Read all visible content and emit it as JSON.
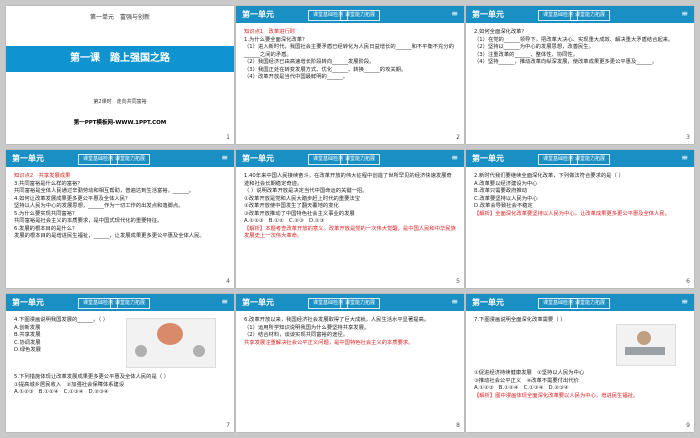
{
  "header": {
    "unit": "第一单元",
    "tag1": "课堂基础检测",
    "tag2": "课堂能力拓展",
    "menu": "≡"
  },
  "slide1": {
    "title_line": "第一单元　富强与创新",
    "band": "第一课　踏上强国之路",
    "subtitle": "第2课时　走向共同富裕",
    "footer": "第一PPT模板网-WWW.1PPT.COM",
    "num": "1"
  },
  "slide2": {
    "lines": [
      "知识点1　改革进行时",
      "1.为什么要全面深化改革？",
      "（1）进入新时代，我国社会主要矛盾已经转化为人民日益增长的______和不平衡不充分的______之间的矛盾。",
      "（2）我国经济已由高速增长阶段转向______发展阶段。",
      "（3）我国正处在转变发展方式、优化______、转换______的攻关期。",
      "（4）改革开放是当代中国最鲜明的______。"
    ],
    "num": "2"
  },
  "slide3": {
    "lines": [
      "2.如何全面深化改革？",
      "（1）在党的______领导下，把改革大决心、实现重大成效、解决重大矛盾结合起来。",
      "（2）坚持以______为中心的发展思想，改善民生。",
      "（3）注重改革的______、整体性、协同性。",
      "（4）坚持______，推动改革向纵深发展，使改革成果更多更公平惠及______。"
    ],
    "num": "3"
  },
  "slide4": {
    "lines": [
      "知识点2　共享发展成果",
      "3.共同富裕是什么样的富裕？",
      "共同富裕是全体人民通过辛勤劳动和相互帮助，普遍达到生活富裕，______。",
      "4.如何让改革发展成果更多更公平惠及全体人民？",
      "坚持以人民为中心的发展思想，______作为一切工作的出发点和落脚点。",
      "5.为什么要实现共同富裕？",
      "共同富裕是社会主义的本质要求，是中国式现代化的重要特征。",
      "6.发展的根本目的是什么？",
      "发展的根本目的是增进民生福祉，______，让发展成果更多更公平惠及全体人民。"
    ],
    "num": "4"
  },
  "slide5": {
    "lines": [
      "1.40年来中国人民接续奋斗，在改革开放的伟大征程中创造了世所罕见的经济快速发展奇迹和社会长期稳定奇迹。",
      "（ ）说明改革开放是决定当代中国命运的关键一招。",
      "①改革开放是党和人民大踏步赶上时代的重要法宝",
      "②改革开放使中国发生了翻天覆地的变化",
      "③改革开放推动了中国特色社会主义事业的发展",
      "A.①②③　B.①②　C.②③　D.①③",
      "【解析】本题考查改革开放的意义。改革开放是党的一次伟大觉醒，是中国人民和中华民族发展史上一次伟大革命。"
    ],
    "num": "5"
  },
  "slide6": {
    "lines": [
      "2.新时代我们要继续全面深化改革，下列做法符合要求的是（ ）",
      "A.改革要以经济建设为中心",
      "B.改革只需要政府推动",
      "C.改革要坚持以人民为中心",
      "D.改革会导致社会不稳定",
      "【解析】全面深化改革要坚持以人民为中心，让改革成果更多更公平惠及全体人民。"
    ],
    "num": "6"
  },
  "slide7": {
    "lines": [
      "4.下图漫画说明我国发展的______。（ ）",
      "A.创新发展",
      "B.共享发展",
      "C.协调发展",
      "D.绿色发展",
      "5.下列措施体现让改革发展成果更多更公平惠及全体人民的是（ ）",
      "①提高城乡居民收入　②加强社会保障体系建设",
      "A.①②③　B.①②④　C.①③④　D.②③④"
    ],
    "num": "7"
  },
  "slide8": {
    "lines": [
      "6.改革开放以来，我国经济社会发展取得了巨大成就，人民生活水平显著提高。",
      "（1）运用所学知识说明我国为什么要坚持共享发展。",
      "（2）结合材料，谈谈实现共同富裕的途径。",
      "共享发展注重解决社会公平正义问题，是中国特色社会主义的本质要求。"
    ],
    "num": "8"
  },
  "slide9": {
    "lines": [
      "7.下图漫画说明全面深化改革需要（ ）",
      "①促进经济持续健康发展　②坚持以人民为中心",
      "③推动社会公平正义　④改革不需要付出代价",
      "A.①②③　B.①②④　C.①③④　D.②③④",
      "【解析】图中漫画体现全面深化改革要以人民为中心，增进民生福祉。"
    ],
    "num": "9"
  }
}
